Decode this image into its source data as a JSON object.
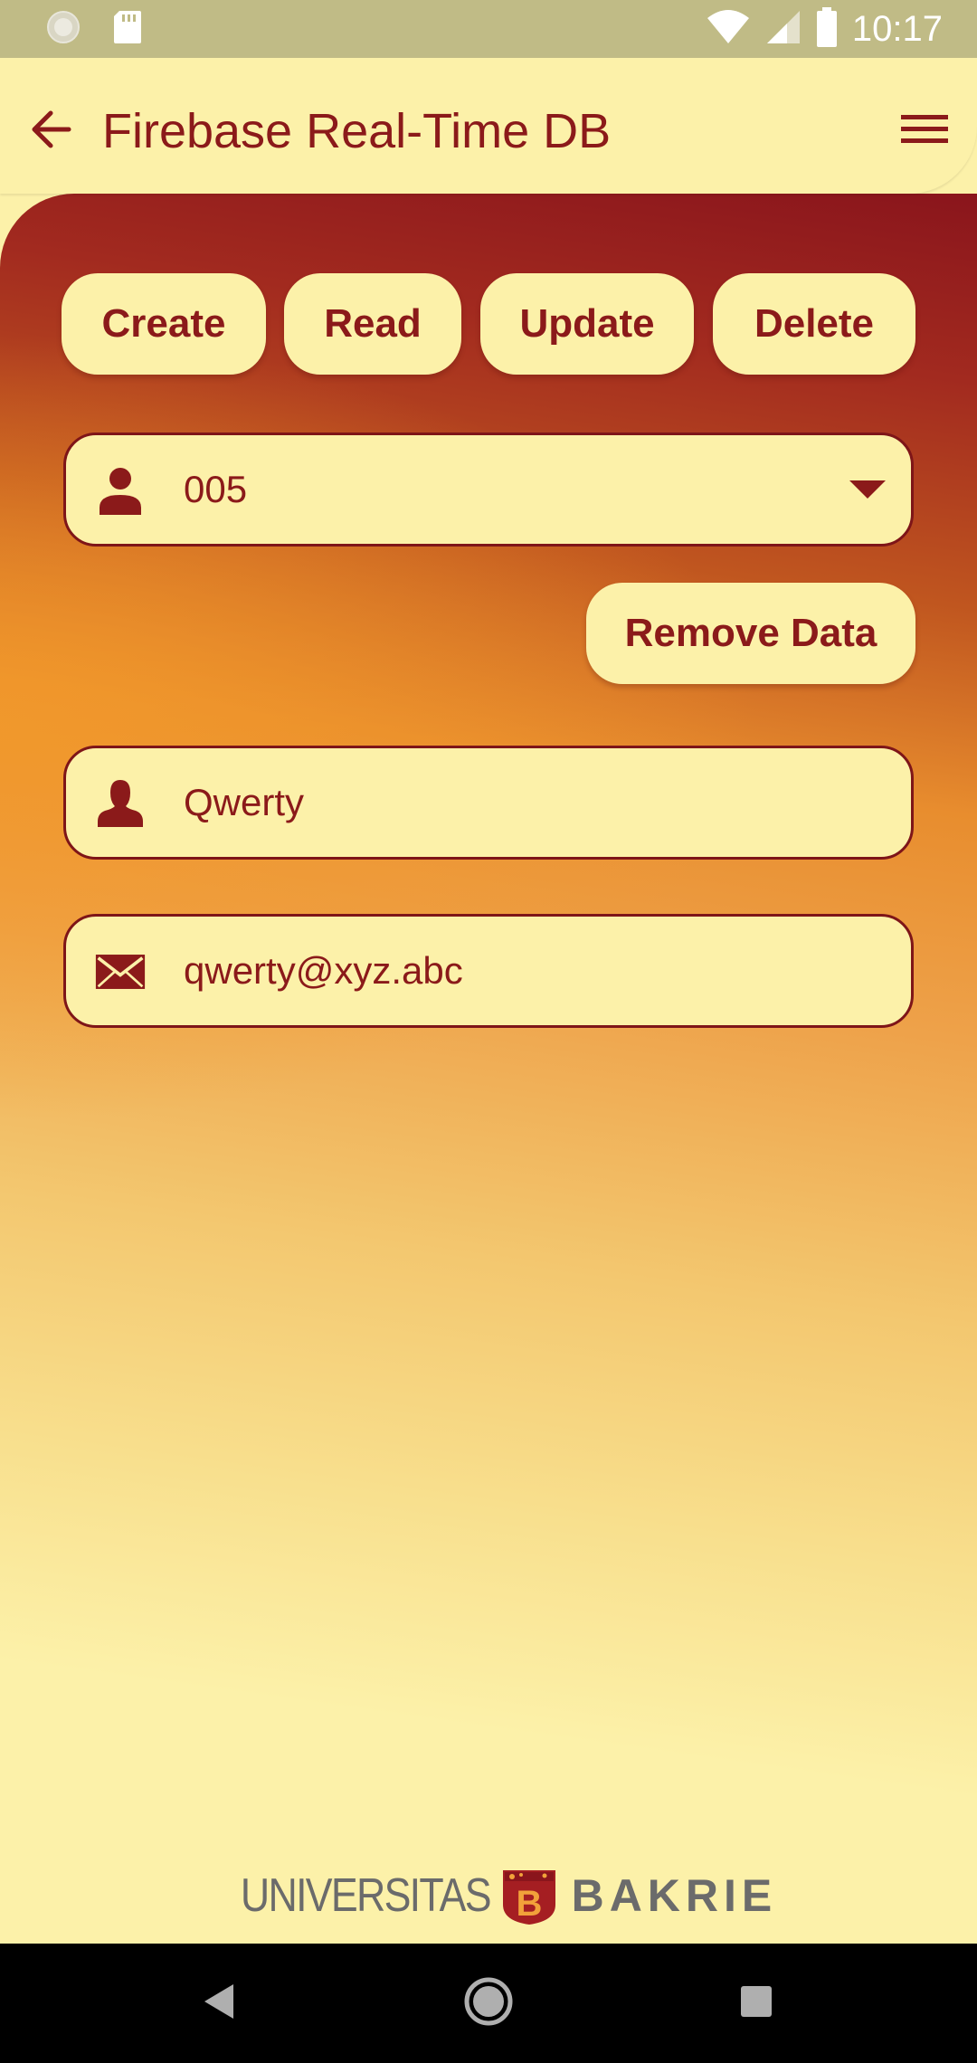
{
  "status_bar": {
    "time": "10:17",
    "left_icons": [
      "circle-notification-icon",
      "sd-card-icon"
    ],
    "right_icons": [
      "wifi-icon",
      "cell-signal-icon",
      "battery-icon"
    ]
  },
  "app_bar": {
    "title": "Firebase Real-Time DB",
    "back_icon": "arrow-back-icon",
    "menu_icon": "hamburger-menu-icon"
  },
  "crud_buttons": [
    {
      "label": "Create"
    },
    {
      "label": "Read"
    },
    {
      "label": "Update"
    },
    {
      "label": "Delete"
    }
  ],
  "id_selector": {
    "icon": "person-icon",
    "selected_value": "005",
    "dropdown_icon": "caret-down-icon"
  },
  "remove_button": {
    "label": "Remove Data"
  },
  "name_field": {
    "icon": "person-silhouette-icon",
    "value": "Qwerty"
  },
  "email_field": {
    "icon": "envelope-icon",
    "value": "qwerty@xyz.abc"
  },
  "footer": {
    "logo_left": "UNIVERSITAS",
    "logo_right": "BAKRIE",
    "logo_mark_letter": "B"
  },
  "colors": {
    "accent": "#8B1A1A",
    "surface": "#FCF1A9",
    "status_bar": "#C0BB86"
  }
}
